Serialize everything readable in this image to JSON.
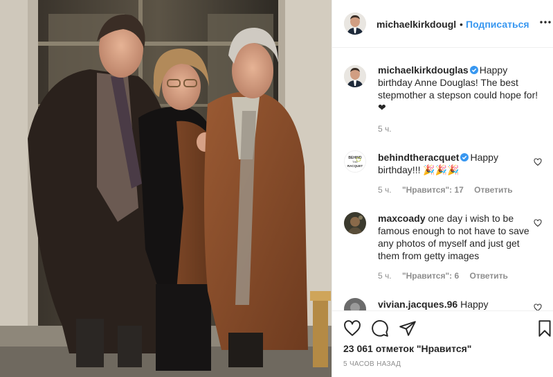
{
  "header": {
    "username": "michaelkirkdougl",
    "separator": "•",
    "follow_label": "Подписаться",
    "more_icon": "more-horizontal-icon"
  },
  "caption": {
    "username": "michaelkirkdouglas",
    "verified": true,
    "text": "Happy birthday Anne Douglas! The best stepmother a stepson could hope for! ❤",
    "time": "5 ч."
  },
  "comments": [
    {
      "username": "behindtheracquet",
      "verified": true,
      "text": "Happy birthday!!! 🎉🎉🎉",
      "time": "5 ч.",
      "likes_label": "\"Нравится\": 17",
      "reply_label": "Ответить",
      "avatar_text": "BEHIND THE RACQUET"
    },
    {
      "username": "maxcoady",
      "verified": false,
      "text": "one day i wish to be famous enough to not have to save any photos of myself and just get them from getty images",
      "time": "5 ч.",
      "likes_label": "\"Нравится\": 6",
      "reply_label": "Ответить"
    },
    {
      "username": "vivian.jacques.96",
      "verified": false,
      "text": "Happy"
    }
  ],
  "actions": {
    "likes_count": "23 061 отметок \"Нравится\"",
    "timestamp": "5 ЧАСОВ НАЗАД"
  },
  "colors": {
    "link_blue": "#3897f0",
    "verified_blue": "#3897f0",
    "text": "#262626",
    "muted": "#8e8e8e",
    "border": "#efefef"
  }
}
